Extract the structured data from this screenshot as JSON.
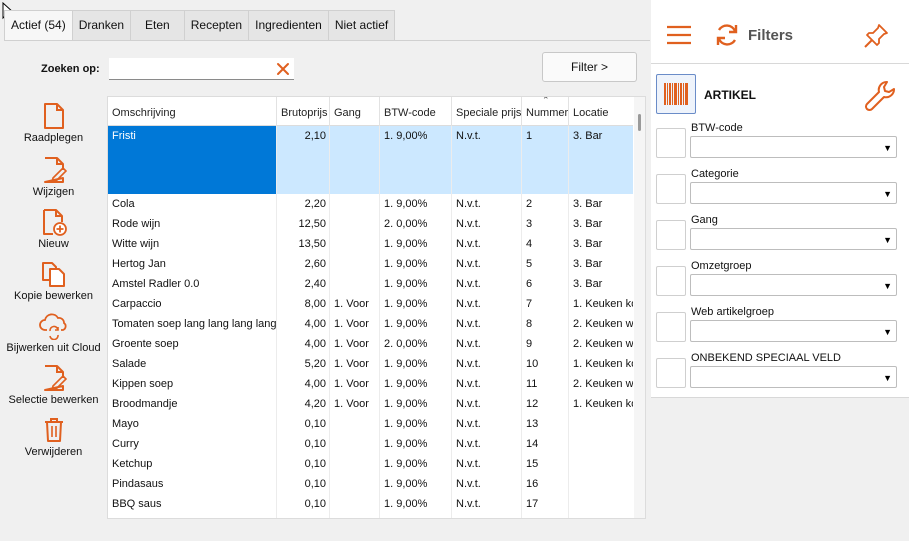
{
  "tabs": [
    {
      "label": "Actief (54)",
      "active": true
    },
    {
      "label": "Dranken",
      "active": false
    },
    {
      "label": "Eten",
      "active": false
    },
    {
      "label": "Recepten",
      "active": false
    },
    {
      "label": "Ingredienten",
      "active": false
    },
    {
      "label": "Niet actief",
      "active": false
    }
  ],
  "search": {
    "label": "Zoeken op:",
    "value": "",
    "filter_button": "Filter >"
  },
  "actions": [
    {
      "label": "Raadplegen",
      "icon": "document-icon"
    },
    {
      "label": "Wijzigen",
      "icon": "edit-document-icon"
    },
    {
      "label": "Nieuw",
      "icon": "new-document-icon"
    },
    {
      "label": "Kopie bewerken",
      "icon": "copy-icon"
    },
    {
      "label": "Bijwerken uit Cloud",
      "icon": "cloud-refresh-icon"
    },
    {
      "label": "Selectie bewerken",
      "icon": "selection-edit-icon"
    },
    {
      "label": "Verwijderen",
      "icon": "trash-icon"
    }
  ],
  "grid": {
    "columns": [
      "Omschrijving",
      "Brutoprijs",
      "Gang",
      "BTW-code",
      "Speciale prijs",
      "Nummer",
      "Locatie"
    ],
    "rows": [
      [
        "Fristi",
        "2,10",
        "",
        "1. 9,00%",
        "N.v.t.",
        "1",
        "3. Bar"
      ],
      [
        "Cola",
        "2,20",
        "",
        "1. 9,00%",
        "N.v.t.",
        "2",
        "3. Bar"
      ],
      [
        "Rode wijn",
        "12,50",
        "",
        "2. 0,00%",
        "N.v.t.",
        "3",
        "3. Bar"
      ],
      [
        "Witte wijn",
        "13,50",
        "",
        "1. 9,00%",
        "N.v.t.",
        "4",
        "3. Bar"
      ],
      [
        "Hertog Jan",
        "2,60",
        "",
        "1. 9,00%",
        "N.v.t.",
        "5",
        "3. Bar"
      ],
      [
        "Amstel Radler 0.0",
        "2,40",
        "",
        "1. 9,00%",
        "N.v.t.",
        "6",
        "3. Bar"
      ],
      [
        "Carpaccio",
        "8,00",
        "1. Voor",
        "1. 9,00%",
        "N.v.t.",
        "7",
        "1. Keuken ko"
      ],
      [
        "Tomaten soep lang lang lang lang",
        "4,00",
        "1. Voor",
        "1. 9,00%",
        "N.v.t.",
        "8",
        "2. Keuken w"
      ],
      [
        "Groente soep",
        "4,00",
        "1. Voor",
        "2. 0,00%",
        "N.v.t.",
        "9",
        "2. Keuken w"
      ],
      [
        "Salade",
        "5,20",
        "1. Voor",
        "1. 9,00%",
        "N.v.t.",
        "10",
        "1. Keuken ko"
      ],
      [
        "Kippen soep",
        "4,00",
        "1. Voor",
        "1. 9,00%",
        "N.v.t.",
        "11",
        "2. Keuken w"
      ],
      [
        "Broodmandje",
        "4,20",
        "1. Voor",
        "1. 9,00%",
        "N.v.t.",
        "12",
        "1. Keuken ko"
      ],
      [
        "Mayo",
        "0,10",
        "",
        "1. 9,00%",
        "N.v.t.",
        "13",
        ""
      ],
      [
        "Curry",
        "0,10",
        "",
        "1. 9,00%",
        "N.v.t.",
        "14",
        ""
      ],
      [
        "Ketchup",
        "0,10",
        "",
        "1. 9,00%",
        "N.v.t.",
        "15",
        ""
      ],
      [
        "Pindasaus",
        "0,10",
        "",
        "1. 9,00%",
        "N.v.t.",
        "16",
        ""
      ],
      [
        "BBQ saus",
        "0,10",
        "",
        "1. 9,00%",
        "N.v.t.",
        "17",
        ""
      ]
    ],
    "selected_row": 0
  },
  "filters": {
    "title": "Filters",
    "section": "ARTIKEL",
    "fields": [
      {
        "label": "BTW-code",
        "value": ""
      },
      {
        "label": "Categorie",
        "value": ""
      },
      {
        "label": "Gang",
        "value": ""
      },
      {
        "label": "Omzetgroep",
        "value": ""
      },
      {
        "label": "Web artikelgroep",
        "value": ""
      },
      {
        "label": "ONBEKEND SPECIAAL VELD",
        "value": ""
      }
    ]
  },
  "colors": {
    "accent": "#e0601f",
    "selection": "#0078d7",
    "row_selection": "#cce8ff"
  }
}
